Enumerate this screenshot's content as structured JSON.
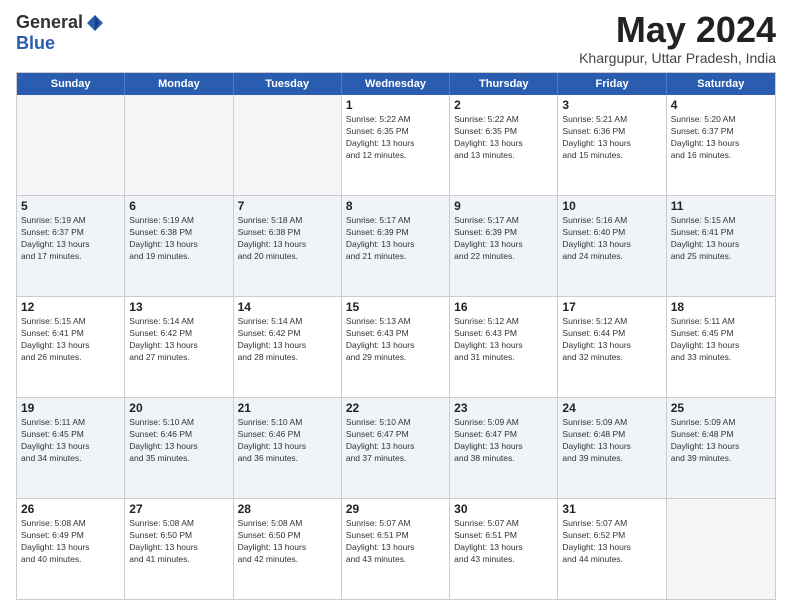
{
  "logo": {
    "general": "General",
    "blue": "Blue"
  },
  "title": "May 2024",
  "subtitle": "Khargupur, Uttar Pradesh, India",
  "days_of_week": [
    "Sunday",
    "Monday",
    "Tuesday",
    "Wednesday",
    "Thursday",
    "Friday",
    "Saturday"
  ],
  "weeks": [
    [
      {
        "day": "",
        "info": ""
      },
      {
        "day": "",
        "info": ""
      },
      {
        "day": "",
        "info": ""
      },
      {
        "day": "1",
        "info": "Sunrise: 5:22 AM\nSunset: 6:35 PM\nDaylight: 13 hours\nand 12 minutes."
      },
      {
        "day": "2",
        "info": "Sunrise: 5:22 AM\nSunset: 6:35 PM\nDaylight: 13 hours\nand 13 minutes."
      },
      {
        "day": "3",
        "info": "Sunrise: 5:21 AM\nSunset: 6:36 PM\nDaylight: 13 hours\nand 15 minutes."
      },
      {
        "day": "4",
        "info": "Sunrise: 5:20 AM\nSunset: 6:37 PM\nDaylight: 13 hours\nand 16 minutes."
      }
    ],
    [
      {
        "day": "5",
        "info": "Sunrise: 5:19 AM\nSunset: 6:37 PM\nDaylight: 13 hours\nand 17 minutes."
      },
      {
        "day": "6",
        "info": "Sunrise: 5:19 AM\nSunset: 6:38 PM\nDaylight: 13 hours\nand 19 minutes."
      },
      {
        "day": "7",
        "info": "Sunrise: 5:18 AM\nSunset: 6:38 PM\nDaylight: 13 hours\nand 20 minutes."
      },
      {
        "day": "8",
        "info": "Sunrise: 5:17 AM\nSunset: 6:39 PM\nDaylight: 13 hours\nand 21 minutes."
      },
      {
        "day": "9",
        "info": "Sunrise: 5:17 AM\nSunset: 6:39 PM\nDaylight: 13 hours\nand 22 minutes."
      },
      {
        "day": "10",
        "info": "Sunrise: 5:16 AM\nSunset: 6:40 PM\nDaylight: 13 hours\nand 24 minutes."
      },
      {
        "day": "11",
        "info": "Sunrise: 5:15 AM\nSunset: 6:41 PM\nDaylight: 13 hours\nand 25 minutes."
      }
    ],
    [
      {
        "day": "12",
        "info": "Sunrise: 5:15 AM\nSunset: 6:41 PM\nDaylight: 13 hours\nand 26 minutes."
      },
      {
        "day": "13",
        "info": "Sunrise: 5:14 AM\nSunset: 6:42 PM\nDaylight: 13 hours\nand 27 minutes."
      },
      {
        "day": "14",
        "info": "Sunrise: 5:14 AM\nSunset: 6:42 PM\nDaylight: 13 hours\nand 28 minutes."
      },
      {
        "day": "15",
        "info": "Sunrise: 5:13 AM\nSunset: 6:43 PM\nDaylight: 13 hours\nand 29 minutes."
      },
      {
        "day": "16",
        "info": "Sunrise: 5:12 AM\nSunset: 6:43 PM\nDaylight: 13 hours\nand 31 minutes."
      },
      {
        "day": "17",
        "info": "Sunrise: 5:12 AM\nSunset: 6:44 PM\nDaylight: 13 hours\nand 32 minutes."
      },
      {
        "day": "18",
        "info": "Sunrise: 5:11 AM\nSunset: 6:45 PM\nDaylight: 13 hours\nand 33 minutes."
      }
    ],
    [
      {
        "day": "19",
        "info": "Sunrise: 5:11 AM\nSunset: 6:45 PM\nDaylight: 13 hours\nand 34 minutes."
      },
      {
        "day": "20",
        "info": "Sunrise: 5:10 AM\nSunset: 6:46 PM\nDaylight: 13 hours\nand 35 minutes."
      },
      {
        "day": "21",
        "info": "Sunrise: 5:10 AM\nSunset: 6:46 PM\nDaylight: 13 hours\nand 36 minutes."
      },
      {
        "day": "22",
        "info": "Sunrise: 5:10 AM\nSunset: 6:47 PM\nDaylight: 13 hours\nand 37 minutes."
      },
      {
        "day": "23",
        "info": "Sunrise: 5:09 AM\nSunset: 6:47 PM\nDaylight: 13 hours\nand 38 minutes."
      },
      {
        "day": "24",
        "info": "Sunrise: 5:09 AM\nSunset: 6:48 PM\nDaylight: 13 hours\nand 39 minutes."
      },
      {
        "day": "25",
        "info": "Sunrise: 5:09 AM\nSunset: 6:48 PM\nDaylight: 13 hours\nand 39 minutes."
      }
    ],
    [
      {
        "day": "26",
        "info": "Sunrise: 5:08 AM\nSunset: 6:49 PM\nDaylight: 13 hours\nand 40 minutes."
      },
      {
        "day": "27",
        "info": "Sunrise: 5:08 AM\nSunset: 6:50 PM\nDaylight: 13 hours\nand 41 minutes."
      },
      {
        "day": "28",
        "info": "Sunrise: 5:08 AM\nSunset: 6:50 PM\nDaylight: 13 hours\nand 42 minutes."
      },
      {
        "day": "29",
        "info": "Sunrise: 5:07 AM\nSunset: 6:51 PM\nDaylight: 13 hours\nand 43 minutes."
      },
      {
        "day": "30",
        "info": "Sunrise: 5:07 AM\nSunset: 6:51 PM\nDaylight: 13 hours\nand 43 minutes."
      },
      {
        "day": "31",
        "info": "Sunrise: 5:07 AM\nSunset: 6:52 PM\nDaylight: 13 hours\nand 44 minutes."
      },
      {
        "day": "",
        "info": ""
      }
    ]
  ]
}
